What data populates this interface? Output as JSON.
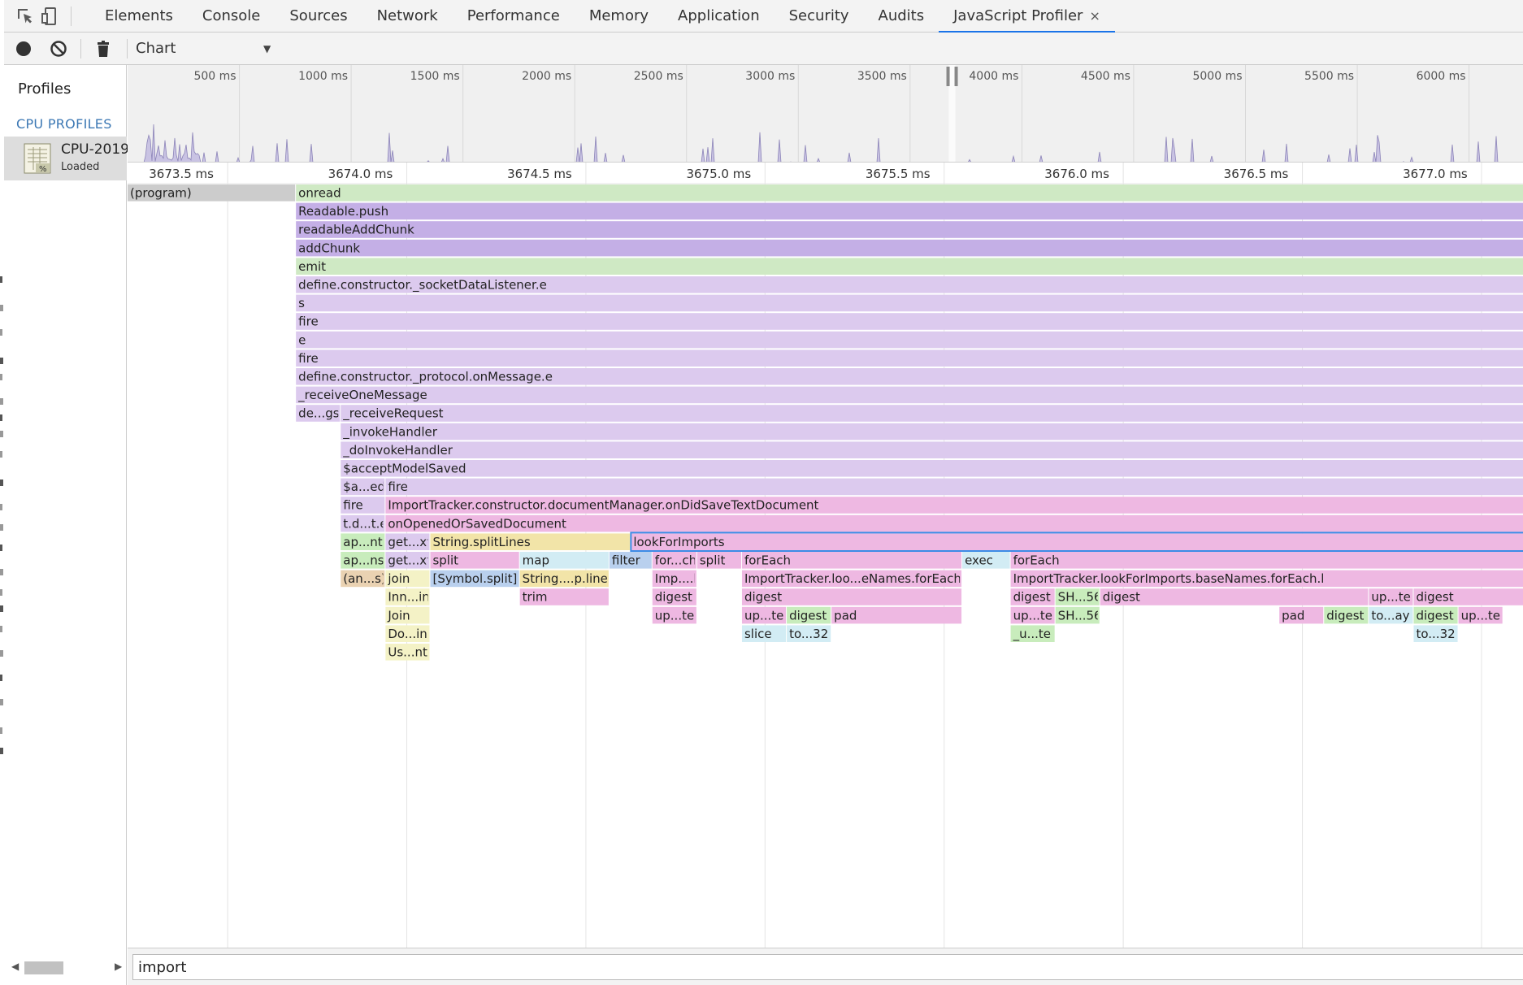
{
  "devtools": {
    "toolbar_icons": [
      "inspect-element-icon",
      "device-toolbar-icon"
    ],
    "tabs": [
      {
        "label": "Elements",
        "active": false
      },
      {
        "label": "Console",
        "active": false
      },
      {
        "label": "Sources",
        "active": false
      },
      {
        "label": "Network",
        "active": false
      },
      {
        "label": "Performance",
        "active": false
      },
      {
        "label": "Memory",
        "active": false
      },
      {
        "label": "Application",
        "active": false
      },
      {
        "label": "Security",
        "active": false
      },
      {
        "label": "Audits",
        "active": false
      },
      {
        "label": "JavaScript Profiler",
        "active": true,
        "closable": true
      }
    ],
    "tab_close_glyph": "×",
    "accent_color": "#1a73e8"
  },
  "profiler_toolbar": {
    "icons": [
      "record-icon",
      "clear-icon",
      "delete-icon"
    ],
    "view_select": {
      "value": "Chart",
      "arrow": "▼"
    }
  },
  "sidebar": {
    "title": "Profiles",
    "section": "CPU PROFILES",
    "profile": {
      "name": "CPU-2019",
      "status": "Loaded",
      "icon": "cpu-profile-icon"
    },
    "scroll_left": "◀",
    "scroll_right": "▶"
  },
  "overview": {
    "ticks": [
      "500 ms",
      "1000 ms",
      "1500 ms",
      "2000 ms",
      "2500 ms",
      "3000 ms",
      "3500 ms",
      "4000 ms",
      "4500 ms",
      "5000 ms",
      "5500 ms",
      "6000 ms"
    ],
    "selection_label_ms": [
      3673.35,
      3677.4
    ]
  },
  "flame": {
    "time_ticks": [
      "3673.5 ms",
      "3674.0 ms",
      "3674.5 ms",
      "3675.0 ms",
      "3675.5 ms",
      "3676.0 ms",
      "3676.5 ms",
      "3677.0 ms"
    ],
    "colors": {
      "program": "#cccccc",
      "green": "#cfe9c4",
      "purple": "#c4afe6",
      "lavender": "#dccaee",
      "pink": "#eeb8e2",
      "yellow": "#f2e4a8",
      "paleyellow": "#f4f2c6",
      "lightgreen": "#c8ecbc",
      "blue": "#b9d0ee",
      "lightblue": "#d2ecf4",
      "orange": "#ead2b2",
      "selection": "#3c8ce6"
    },
    "selected": "lookForImports",
    "frames": [
      {
        "label": "(program)",
        "color": "program",
        "depth": 0,
        "start": 3673.35,
        "end": 3673.82
      },
      {
        "label": "onread",
        "color": "green",
        "depth": 0,
        "start": 3673.82,
        "end": 3677.4
      },
      {
        "label": "Readable.push",
        "color": "purple",
        "depth": 1,
        "start": 3673.82,
        "end": 3677.4
      },
      {
        "label": "readableAddChunk",
        "color": "purple",
        "depth": 2,
        "start": 3673.82,
        "end": 3677.4
      },
      {
        "label": "addChunk",
        "color": "purple",
        "depth": 3,
        "start": 3673.82,
        "end": 3677.4
      },
      {
        "label": "emit",
        "color": "green",
        "depth": 4,
        "start": 3673.82,
        "end": 3677.4
      },
      {
        "label": "define.constructor._socketDataListener.e",
        "color": "lavender",
        "depth": 5,
        "start": 3673.82,
        "end": 3677.4
      },
      {
        "label": "s",
        "color": "lavender",
        "depth": 6,
        "start": 3673.82,
        "end": 3677.4
      },
      {
        "label": "fire",
        "color": "lavender",
        "depth": 7,
        "start": 3673.82,
        "end": 3677.4
      },
      {
        "label": "e",
        "color": "lavender",
        "depth": 8,
        "start": 3673.82,
        "end": 3677.4
      },
      {
        "label": "fire",
        "color": "lavender",
        "depth": 9,
        "start": 3673.82,
        "end": 3677.4
      },
      {
        "label": "define.constructor._protocol.onMessage.e",
        "color": "lavender",
        "depth": 10,
        "start": 3673.82,
        "end": 3677.4
      },
      {
        "label": "_receiveOneMessage",
        "color": "lavender",
        "depth": 11,
        "start": 3673.82,
        "end": 3677.4
      },
      {
        "label": "de...gs",
        "color": "lavender",
        "depth": 12,
        "start": 3673.82,
        "end": 3673.945
      },
      {
        "label": "_receiveRequest",
        "color": "lavender",
        "depth": 12,
        "start": 3673.945,
        "end": 3677.4
      },
      {
        "label": "_invokeHandler",
        "color": "lavender",
        "depth": 13,
        "start": 3673.945,
        "end": 3677.4
      },
      {
        "label": "_doInvokeHandler",
        "color": "lavender",
        "depth": 14,
        "start": 3673.945,
        "end": 3677.4
      },
      {
        "label": "$acceptModelSaved",
        "color": "lavender",
        "depth": 15,
        "start": 3673.945,
        "end": 3677.4
      },
      {
        "label": "$a...ed",
        "color": "lavender",
        "depth": 16,
        "start": 3673.945,
        "end": 3674.07
      },
      {
        "label": "fire",
        "color": "lavender",
        "depth": 16,
        "start": 3674.07,
        "end": 3677.4
      },
      {
        "label": "fire",
        "color": "lavender",
        "depth": 17,
        "start": 3673.945,
        "end": 3674.07
      },
      {
        "label": "ImportTracker.constructor.documentManager.onDidSaveTextDocument",
        "color": "pink",
        "depth": 17,
        "start": 3674.07,
        "end": 3677.4
      },
      {
        "label": "t.d...t.e",
        "color": "lavender",
        "depth": 18,
        "start": 3673.945,
        "end": 3674.07
      },
      {
        "label": "onOpenedOrSavedDocument",
        "color": "pink",
        "depth": 18,
        "start": 3674.07,
        "end": 3677.4
      },
      {
        "label": "ap...nt",
        "color": "lightgreen",
        "depth": 19,
        "start": 3673.945,
        "end": 3674.07
      },
      {
        "label": "get...xt",
        "color": "lavender",
        "depth": 19,
        "start": 3674.07,
        "end": 3674.195
      },
      {
        "label": "String.splitLines",
        "color": "yellow",
        "depth": 19,
        "start": 3674.195,
        "end": 3674.755
      },
      {
        "label": "lookForImports",
        "color": "pink",
        "depth": 19,
        "start": 3674.755,
        "end": 3677.4
      },
      {
        "label": "ap...ns",
        "color": "lightgreen",
        "depth": 20,
        "start": 3673.945,
        "end": 3674.07
      },
      {
        "label": "get...xt",
        "color": "lavender",
        "depth": 20,
        "start": 3674.07,
        "end": 3674.195
      },
      {
        "label": "split",
        "color": "pink",
        "depth": 20,
        "start": 3674.195,
        "end": 3674.445
      },
      {
        "label": "map",
        "color": "lightblue",
        "depth": 20,
        "start": 3674.445,
        "end": 3674.695
      },
      {
        "label": "filter",
        "color": "blue",
        "depth": 20,
        "start": 3674.695,
        "end": 3674.815
      },
      {
        "label": "for...ch",
        "color": "pink",
        "depth": 20,
        "start": 3674.815,
        "end": 3674.94
      },
      {
        "label": "split",
        "color": "pink",
        "depth": 20,
        "start": 3674.94,
        "end": 3675.065
      },
      {
        "label": "forEach",
        "color": "pink",
        "depth": 20,
        "start": 3675.065,
        "end": 3675.68
      },
      {
        "label": "exec",
        "color": "lightblue",
        "depth": 20,
        "start": 3675.68,
        "end": 3675.815
      },
      {
        "label": "forEach",
        "color": "pink",
        "depth": 20,
        "start": 3675.815,
        "end": 3677.3
      },
      {
        "label": "(an...s)",
        "color": "orange",
        "depth": 21,
        "start": 3673.945,
        "end": 3674.07
      },
      {
        "label": "join",
        "color": "paleyellow",
        "depth": 21,
        "start": 3674.07,
        "end": 3674.195
      },
      {
        "label": "[Symbol.split]",
        "color": "blue",
        "depth": 21,
        "start": 3674.195,
        "end": 3674.445
      },
      {
        "label": "String....p.line",
        "color": "yellow",
        "depth": 21,
        "start": 3674.445,
        "end": 3674.695
      },
      {
        "label": "Imp....l",
        "color": "pink",
        "depth": 21,
        "start": 3674.815,
        "end": 3674.94
      },
      {
        "label": "ImportTracker.loo...eNames.forEach.l",
        "color": "pink",
        "depth": 21,
        "start": 3675.065,
        "end": 3675.68
      },
      {
        "label": "ImportTracker.lookForImports.baseNames.forEach.l",
        "color": "pink",
        "depth": 21,
        "start": 3675.815,
        "end": 3677.3
      },
      {
        "label": "Inn...in",
        "color": "paleyellow",
        "depth": 22,
        "start": 3674.07,
        "end": 3674.195
      },
      {
        "label": "trim",
        "color": "pink",
        "depth": 22,
        "start": 3674.445,
        "end": 3674.695
      },
      {
        "label": "digest",
        "color": "pink",
        "depth": 22,
        "start": 3674.815,
        "end": 3674.94
      },
      {
        "label": "digest",
        "color": "pink",
        "depth": 22,
        "start": 3675.065,
        "end": 3675.68
      },
      {
        "label": "digest",
        "color": "pink",
        "depth": 22,
        "start": 3675.815,
        "end": 3675.94
      },
      {
        "label": "SH...56",
        "color": "lightgreen",
        "depth": 22,
        "start": 3675.94,
        "end": 3676.065
      },
      {
        "label": "digest",
        "color": "pink",
        "depth": 22,
        "start": 3676.065,
        "end": 3676.815
      },
      {
        "label": "up...te",
        "color": "pink",
        "depth": 22,
        "start": 3676.815,
        "end": 3676.94
      },
      {
        "label": "digest",
        "color": "pink",
        "depth": 22,
        "start": 3676.94,
        "end": 3677.3
      },
      {
        "label": "Join",
        "color": "paleyellow",
        "depth": 23,
        "start": 3674.07,
        "end": 3674.195
      },
      {
        "label": "up...te",
        "color": "pink",
        "depth": 23,
        "start": 3674.815,
        "end": 3674.94
      },
      {
        "label": "up...te",
        "color": "pink",
        "depth": 23,
        "start": 3675.065,
        "end": 3675.19
      },
      {
        "label": "digest",
        "color": "lightgreen",
        "depth": 23,
        "start": 3675.19,
        "end": 3675.315
      },
      {
        "label": "pad",
        "color": "pink",
        "depth": 23,
        "start": 3675.315,
        "end": 3675.68
      },
      {
        "label": "up...te",
        "color": "pink",
        "depth": 23,
        "start": 3675.815,
        "end": 3675.94
      },
      {
        "label": "SH...56",
        "color": "lightgreen",
        "depth": 23,
        "start": 3675.94,
        "end": 3676.065
      },
      {
        "label": "pad",
        "color": "pink",
        "depth": 23,
        "start": 3676.565,
        "end": 3676.69
      },
      {
        "label": "digest",
        "color": "lightgreen",
        "depth": 23,
        "start": 3676.69,
        "end": 3676.815
      },
      {
        "label": "to...ay",
        "color": "lightblue",
        "depth": 23,
        "start": 3676.815,
        "end": 3676.94
      },
      {
        "label": "digest",
        "color": "lightgreen",
        "depth": 23,
        "start": 3676.94,
        "end": 3677.065
      },
      {
        "label": "up...te",
        "color": "pink",
        "depth": 23,
        "start": 3677.065,
        "end": 3677.19
      },
      {
        "label": "Do...in",
        "color": "paleyellow",
        "depth": 24,
        "start": 3674.07,
        "end": 3674.195
      },
      {
        "label": "slice",
        "color": "lightblue",
        "depth": 24,
        "start": 3675.065,
        "end": 3675.19
      },
      {
        "label": "to...32",
        "color": "lightblue",
        "depth": 24,
        "start": 3675.19,
        "end": 3675.315
      },
      {
        "label": "_u...te",
        "color": "lightgreen",
        "depth": 24,
        "start": 3675.815,
        "end": 3675.94
      },
      {
        "label": "to...32",
        "color": "lightblue",
        "depth": 24,
        "start": 3676.94,
        "end": 3677.065
      },
      {
        "label": "Us...nt",
        "color": "paleyellow",
        "depth": 25,
        "start": 3674.07,
        "end": 3674.195
      }
    ]
  },
  "search": {
    "value": "import"
  }
}
